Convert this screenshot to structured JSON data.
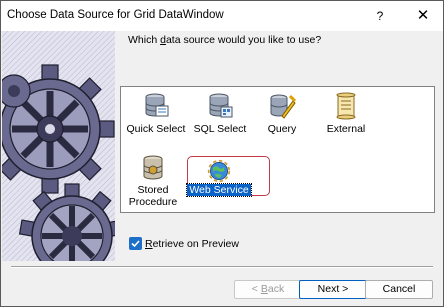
{
  "window": {
    "title": "Choose Data Source for Grid DataWindow",
    "help_label": "?",
    "close_label": "✕"
  },
  "prompt": {
    "pre": "Which ",
    "accel": "d",
    "post": "ata source would you like to use?"
  },
  "sources": [
    {
      "label": "Quick Select",
      "icon": "quick-select-database-icon"
    },
    {
      "label": "SQL Select",
      "icon": "sql-select-database-icon"
    },
    {
      "label": "Query",
      "icon": "query-database-icon"
    },
    {
      "label": "External",
      "icon": "external-scroll-icon"
    },
    {
      "label_line1": "Stored",
      "label_line2": "Procedure",
      "icon": "stored-procedure-icon"
    },
    {
      "label": "Web Service",
      "icon": "web-service-globe-icon",
      "selected": true
    }
  ],
  "retrieve": {
    "checked": true,
    "accel": "R",
    "rest": "etrieve on Preview"
  },
  "buttons": {
    "back_pre": "< ",
    "back_accel": "B",
    "back_post": "ack",
    "next": "Next >",
    "cancel": "Cancel"
  },
  "colors": {
    "selection_highlight": "#0a64c8",
    "selection_outline": "#c33a4a",
    "checkbox": "#1e6fc8"
  }
}
